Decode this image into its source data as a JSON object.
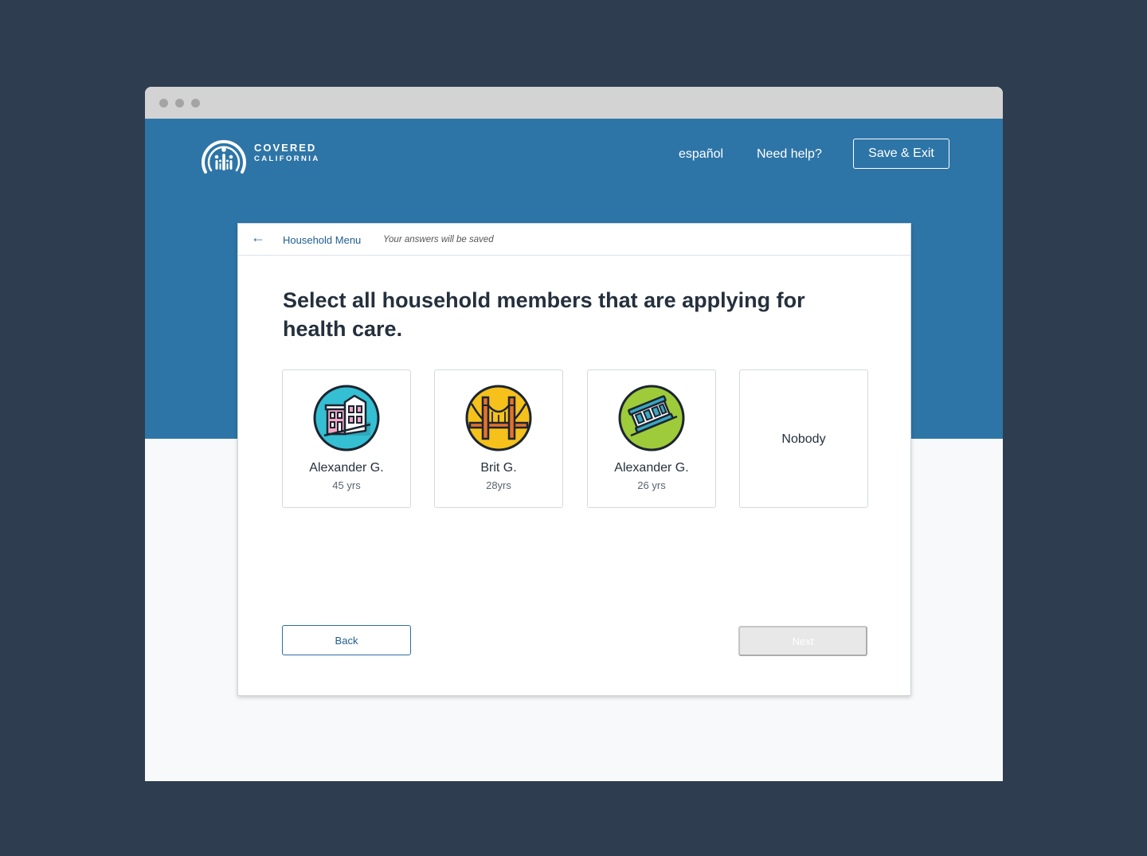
{
  "header": {
    "logo_line1": "COVERED",
    "logo_line2": "CALIFORNIA",
    "language_link": "español",
    "help_link": "Need help?",
    "save_exit_label": "Save & Exit"
  },
  "breadcrumb": {
    "back_arrow": "←",
    "menu_label": "Household Menu",
    "saved_note": "Your answers will be saved"
  },
  "question": "Select all household members that are applying for health care.",
  "members": [
    {
      "name": "Alexander G.",
      "age": "45 yrs",
      "icon": "houses-icon",
      "color": "#34bfd3"
    },
    {
      "name": "Brit G.",
      "age": "28yrs",
      "icon": "golden-gate-bridge-icon",
      "color": "#f5c11a"
    },
    {
      "name": "Alexander G.",
      "age": "26 yrs",
      "icon": "cable-car-icon",
      "color": "#9dcb3a"
    }
  ],
  "nobody_label": "Nobody",
  "buttons": {
    "back_label": "Back",
    "next_label": "Next"
  },
  "colors": {
    "page_background": "#2e3d4f",
    "brand_blue": "#2e75a7",
    "link_blue": "#1f5d8f",
    "disabled_button": "#e8e8e8"
  }
}
